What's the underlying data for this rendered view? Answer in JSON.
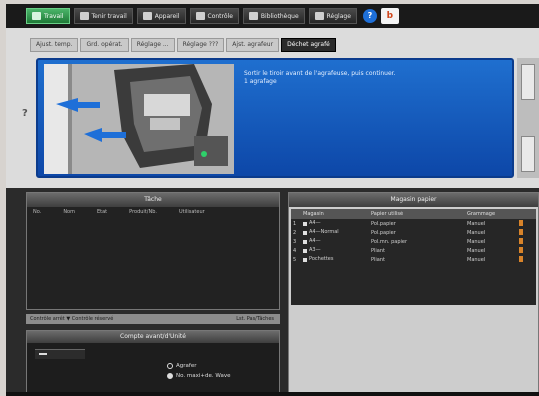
{
  "topbar": {
    "items": [
      {
        "label": "Travail",
        "active": true
      },
      {
        "label": "Tenir travail",
        "active": false
      },
      {
        "label": "Appareil",
        "active": false
      },
      {
        "label": "Contrôle",
        "active": false
      },
      {
        "label": "Bibliothèque",
        "active": false
      },
      {
        "label": "Réglage",
        "active": false
      }
    ],
    "help_label": "?",
    "brand_glyph": "b"
  },
  "tabs": [
    {
      "label": "Ajust. temp.",
      "selected": false
    },
    {
      "label": "Grd. opérat.",
      "selected": false
    },
    {
      "label": "Réglage ...",
      "selected": false
    },
    {
      "label": "Réglage ???",
      "selected": false
    },
    {
      "label": "Ajst. agrafeur",
      "selected": false
    },
    {
      "label": "Déchet agrafé",
      "selected": true
    }
  ],
  "help": {
    "left_glyph": "?"
  },
  "guide": {
    "message_line1": "Sortir le tiroir avant de l'agrafeuse, puis continuer.",
    "message_line2": "1 agrafage"
  },
  "left_panel": {
    "title": "Tâche",
    "columns": [
      "No.",
      "Nom",
      "Etat",
      "Produit/Nb.",
      "Utilisateur"
    ],
    "footer_left": "Contrôle arrêt  ▼  Contrôle réservé",
    "footer_right": "Lst. Pas/Tâches"
  },
  "bottom_left_panel": {
    "title": "Compte avant/d'Unité",
    "options": [
      {
        "label": "Agrafer",
        "selected": false
      },
      {
        "label": "No. maxi+de. Wave",
        "selected": true
      }
    ]
  },
  "right_panel": {
    "title": "Magasin papier",
    "columns": [
      "Magasin",
      "",
      "Papier utilisé",
      "Grammage",
      ""
    ],
    "rows": [
      {
        "index": "1",
        "name": "A4—",
        "paper": "Pol.papier",
        "weight": "Manuel"
      },
      {
        "index": "2",
        "name": "A4—Normal",
        "paper": "Pol.papier",
        "weight": "Manuel"
      },
      {
        "index": "3",
        "name": "A4—",
        "paper": "Pol.mn. papier",
        "weight": "Manuel"
      },
      {
        "index": "4",
        "name": "A3—",
        "paper": "Pliant",
        "weight": "Manuel"
      },
      {
        "index": "5",
        "name": "Pochettes",
        "paper": "Pliant",
        "weight": "Manuel"
      }
    ]
  },
  "colors": {
    "accent_green": "#2f9a4d",
    "guide_blue": "#1f6fcf",
    "status_orange": "#d9842a"
  }
}
